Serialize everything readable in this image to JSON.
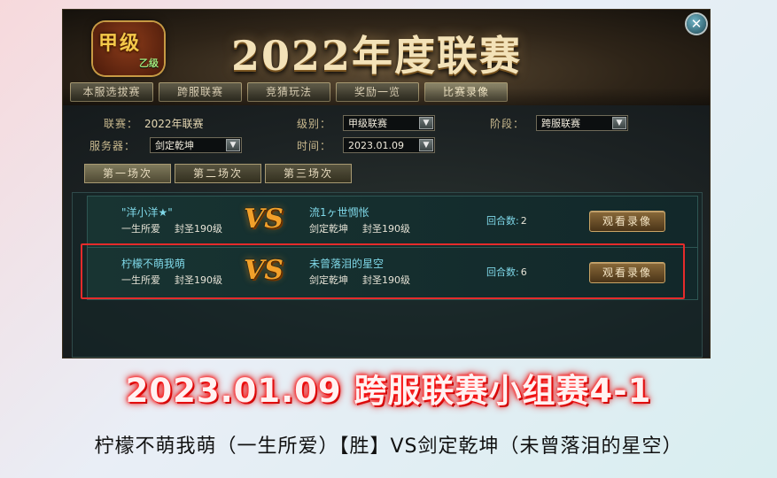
{
  "window": {
    "logo_main": "甲级",
    "logo_sub": "乙级",
    "title": "2022年度联赛",
    "close_glyph": "✕"
  },
  "tabs": [
    {
      "label": "本服选拔赛",
      "active": false
    },
    {
      "label": "跨服联赛",
      "active": false
    },
    {
      "label": "竞猜玩法",
      "active": false
    },
    {
      "label": "奖励一览",
      "active": false
    },
    {
      "label": "比赛录像",
      "active": true
    }
  ],
  "filters": {
    "league_label": "联赛：",
    "league_value": "2022年联赛",
    "level_label": "级别：",
    "level_value": "甲级联赛",
    "stage_label": "阶段：",
    "stage_value": "跨服联赛",
    "server_label": "服务器：",
    "server_value": "剑定乾坤",
    "time_label": "时间：",
    "time_value": "2023.01.09"
  },
  "subtabs": [
    {
      "label": "第一场次",
      "active": true
    },
    {
      "label": "第二场次",
      "active": false
    },
    {
      "label": "第三场次",
      "active": false
    }
  ],
  "matches": [
    {
      "left_name": "\"洋小洋★\"",
      "left_guild": "一生所爱",
      "left_rank": "封圣190级",
      "vs": "VS",
      "right_name": "流1ヶ世惆怅",
      "right_guild": "剑定乾坤",
      "right_rank": "封圣190级",
      "rounds_label": "回合数:",
      "rounds_value": "2",
      "button": "观看录像"
    },
    {
      "left_name": "柠檬不萌我萌",
      "left_guild": "一生所爱",
      "left_rank": "封圣190级",
      "vs": "VS",
      "right_name": "未曾落泪的星空",
      "right_guild": "剑定乾坤",
      "right_rank": "封圣190级",
      "rounds_label": "回合数:",
      "rounds_value": "6",
      "button": "观看录像"
    }
  ],
  "overlay": {
    "headline": "2023.01.09 跨服联赛小组赛4-1",
    "caption": "柠檬不萌我萌（一生所爱）【胜】VS剑定乾坤（未曾落泪的星空）",
    "headline_color": "#ff2020",
    "highlight_color": "#e52b2b"
  }
}
